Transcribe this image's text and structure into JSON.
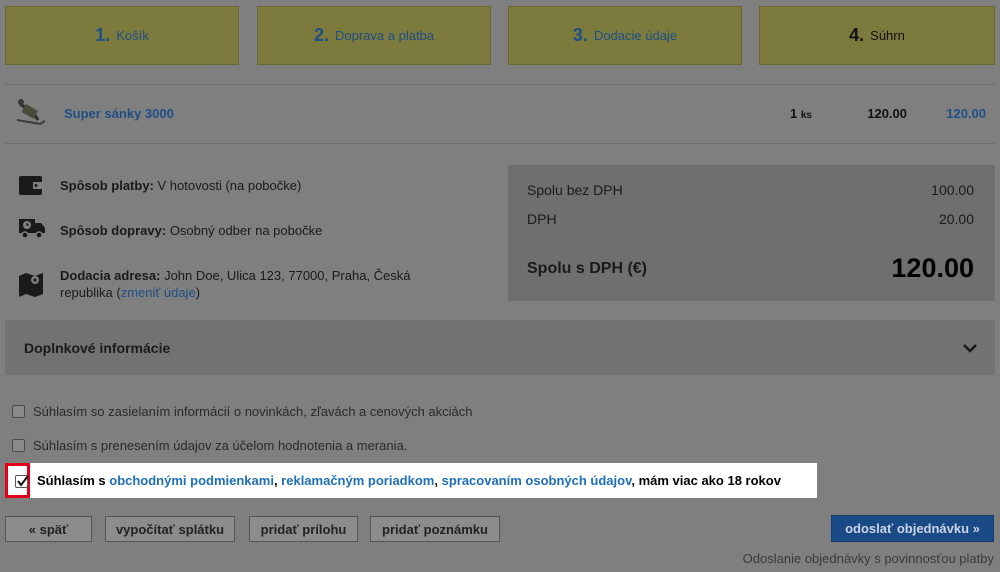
{
  "steps": [
    {
      "num": "1.",
      "label": "Košík"
    },
    {
      "num": "2.",
      "label": "Doprava a platba"
    },
    {
      "num": "3.",
      "label": "Dodacie údaje"
    },
    {
      "num": "4.",
      "label": "Súhrn"
    }
  ],
  "product": {
    "name": "Super sánky 3000",
    "qty": "1",
    "unit": "ks",
    "price": "120.00",
    "total": "120.00"
  },
  "info": {
    "payment_label": "Spôsob platby:",
    "payment_value": "V hotovosti (na pobočke)",
    "shipping_label": "Spôsob dopravy:",
    "shipping_value": "Osobný odber na pobočke",
    "address_label": "Dodacia adresa:",
    "address_value": "John Doe, Ulica 123, 77000, Praha, Česká republika (",
    "address_change": "zmeniť údaje",
    "address_close": ")"
  },
  "totals": {
    "net_label": "Spolu bez DPH",
    "net_value": "100.00",
    "vat_label": "DPH",
    "vat_value": "20.00",
    "gross_label": "Spolu s DPH (€)",
    "gross_value": "120.00"
  },
  "accordion": {
    "title": "Doplnkové informácie"
  },
  "options": {
    "newsletter": "Súhlasím so zasielaním informácií o novinkách, zľavách a cenových akciách",
    "analytics": "Súhlasím s prenesením údajov za účelom hodnotenia a merania."
  },
  "consent": {
    "prefix": "Súhlasím s ",
    "terms": "obchodnými podmienkami",
    "sep1": ", ",
    "complaints": "reklamačným poriadkom",
    "sep2": ", ",
    "privacy": "spracovaním osobných údajov",
    "suffix": ", mám viac ako 18 rokov"
  },
  "buttons": {
    "back": "« späť",
    "installment": "vypočítať splátku",
    "attachment": "pridať prílohu",
    "note": "pridať poznámku",
    "submit": "odoslať objednávku »"
  },
  "submit_note": "Odoslanie objednávky s povinnosťou platby"
}
